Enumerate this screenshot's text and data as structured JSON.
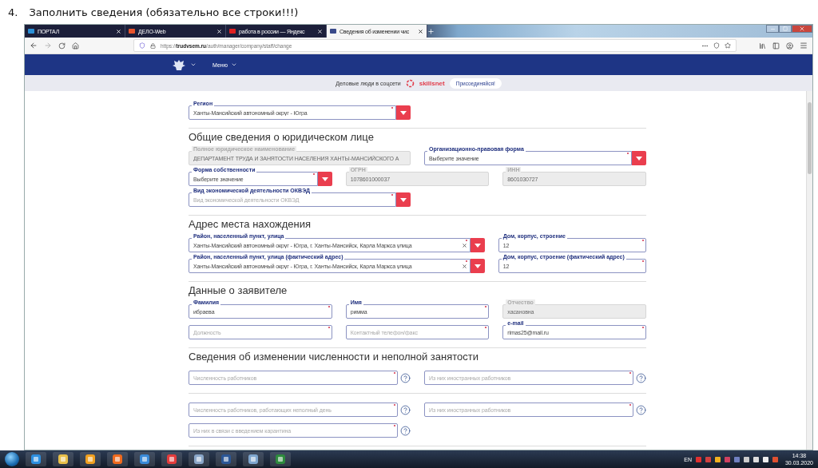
{
  "instruction": {
    "number": "4.",
    "text": "Заполнить сведения (обязательно все строки!!!)"
  },
  "browser": {
    "tabs": [
      {
        "title": "ПОРТАЛ",
        "color": "#2a8fd6",
        "selected": false
      },
      {
        "title": "ДЕЛО-Web",
        "color": "#e8542c",
        "selected": false
      },
      {
        "title": "работа в россии — Яндекс",
        "color": "#e02020",
        "selected": false
      },
      {
        "title": "Сведения об изменении чис",
        "color": "#3a4a8a",
        "selected": true
      }
    ],
    "url": "https://**trudvsem.ru**/auth/manager/company/staff/change"
  },
  "site_header": {
    "menu": "Меню"
  },
  "banner": {
    "text": "Деловые люди в соцсети",
    "logo": "skillsnet",
    "button": "Присоединяйся!"
  },
  "form": {
    "sections": [
      {
        "rows": [
          {
            "kind": "half",
            "fields": [
              {
                "kind": "select",
                "label": "Регион",
                "value": "Ханты-Мансийский автономный округ - Югра",
                "required": true,
                "disabled": false,
                "clear": false,
                "help": false
              }
            ]
          }
        ]
      },
      {
        "title": "Общие сведения о юридическом лице",
        "rows": [
          {
            "kind": "half",
            "fields": [
              {
                "kind": "text",
                "label": "Полное юридическое наименование",
                "value": "ДЕПАРТАМЕНТ ТРУДА И ЗАНЯТОСТИ НАСЕЛЕНИЯ ХАНТЫ-МАНСИЙСКОГО А",
                "required": false,
                "disabled": true,
                "clear": false,
                "help": false
              },
              {
                "kind": "select",
                "label": "Организационно-правовая форма",
                "value": "Выберите значение",
                "required": true,
                "disabled": false,
                "clear": false,
                "help": false
              }
            ]
          },
          {
            "kind": "triple",
            "fields": [
              {
                "kind": "select",
                "label": "Форма собственности",
                "value": "Выберите значение",
                "required": true,
                "disabled": false,
                "clear": false,
                "help": false
              },
              {
                "kind": "text",
                "label": "ОГРН",
                "value": "1078601000037",
                "required": false,
                "disabled": true,
                "clear": false,
                "help": false
              },
              {
                "kind": "text",
                "label": "ИНН",
                "value": "8601030727",
                "required": false,
                "disabled": true,
                "clear": false,
                "help": false
              }
            ]
          },
          {
            "kind": "half",
            "fields": [
              {
                "kind": "select",
                "label": "Вид экономической деятельности ОКВЭД",
                "placeholder": "Вид экономической деятельности ОКВЭД",
                "required": true,
                "disabled": false,
                "clear": false,
                "help": false
              }
            ]
          }
        ]
      },
      {
        "title": "Адрес места нахождения",
        "rows": [
          {
            "kind": "wide",
            "fields": [
              {
                "kind": "select",
                "label": "Район, населенный пункт, улица",
                "value": "Ханты-Мансийский автономный округ - Югра, г. Ханты-Мансийск, Карла Маркса улица",
                "required": true,
                "disabled": false,
                "clear": true,
                "help": false
              },
              {
                "kind": "text",
                "label": "Дом, корпус, строение",
                "value": "12",
                "required": true,
                "disabled": false,
                "clear": false,
                "help": false
              }
            ]
          },
          {
            "kind": "wide",
            "fields": [
              {
                "kind": "select",
                "label": "Район, населенный пункт, улица (фактический адрес)",
                "value": "Ханты-Мансийский автономный округ - Югра, г. Ханты-Мансийск, Карла Маркса улица",
                "required": true,
                "disabled": false,
                "clear": true,
                "help": false
              },
              {
                "kind": "text",
                "label": "Дом, корпус, строение (фактический адрес)",
                "value": "12",
                "required": true,
                "disabled": false,
                "clear": false,
                "help": false
              }
            ]
          }
        ]
      },
      {
        "title": "Данные о заявителе",
        "rows": [
          {
            "kind": "triple",
            "fields": [
              {
                "kind": "text",
                "label": "Фамилия",
                "value": "ибраева",
                "required": true,
                "disabled": false,
                "clear": false,
                "help": false
              },
              {
                "kind": "text",
                "label": "Имя",
                "value": "римма",
                "required": true,
                "disabled": false,
                "clear": false,
                "help": false
              },
              {
                "kind": "text",
                "label": "Отчество",
                "value": "хасановна",
                "required": false,
                "disabled": true,
                "clear": false,
                "help": false
              }
            ]
          },
          {
            "kind": "triple",
            "fields": [
              {
                "kind": "text",
                "placeholder": "Должность",
                "required": true,
                "disabled": false,
                "clear": false,
                "help": false
              },
              {
                "kind": "text",
                "placeholder": "Контактный телефон/факс",
                "required": true,
                "disabled": false,
                "clear": false,
                "help": false
              },
              {
                "kind": "text",
                "label": "e-mail",
                "value": "rimas25@mail.ru",
                "required": true,
                "disabled": false,
                "clear": false,
                "help": false
              }
            ]
          }
        ]
      },
      {
        "title": "Сведения об изменении численности и неполной занятости",
        "rows": [
          {
            "kind": "half",
            "fields": [
              {
                "kind": "text",
                "placeholder": "Численность работников",
                "required": true,
                "disabled": false,
                "clear": false,
                "help": true
              },
              {
                "kind": "text",
                "placeholder": "Из них иностранных работников",
                "required": true,
                "disabled": false,
                "clear": false,
                "help": true
              }
            ]
          }
        ]
      },
      {
        "rows": [
          {
            "kind": "half",
            "fields": [
              {
                "kind": "text",
                "placeholder": "Численность работников, работающих неполный день",
                "required": true,
                "disabled": false,
                "clear": false,
                "help": true
              },
              {
                "kind": "text",
                "placeholder": "Из них иностранных работников",
                "required": true,
                "disabled": false,
                "clear": false,
                "help": true
              }
            ]
          },
          {
            "kind": "half",
            "fields": [
              {
                "kind": "text",
                "placeholder": "Из них в связи с введением карантина",
                "required": true,
                "disabled": false,
                "clear": false,
                "help": true
              }
            ]
          }
        ]
      }
    ]
  },
  "taskbar": {
    "language": "EN",
    "time": "14:38",
    "date": "30.03.2020"
  }
}
